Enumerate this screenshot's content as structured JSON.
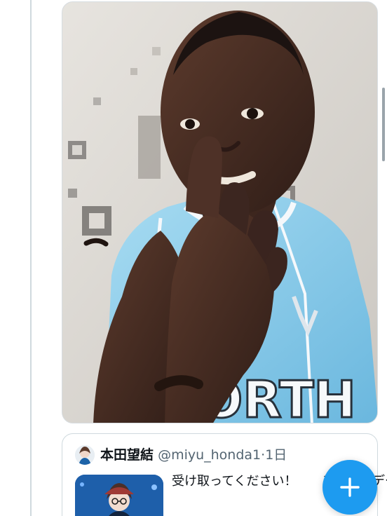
{
  "media": {
    "jersey_text": "ORTH"
  },
  "quote_tweet": {
    "author_name": "本田望結",
    "author_handle": "@miyu_honda1",
    "separator": "·",
    "timestamp": "1日",
    "text": "受け取ってください！",
    "text_tail": "ンタインデー"
  },
  "compose_button": {
    "icon": "plus-icon"
  },
  "colors": {
    "accent": "#1d9bf0",
    "border": "#cfd9de",
    "text_primary": "#0f1419",
    "text_secondary": "#536471",
    "jersey": "#8ec9e8"
  }
}
